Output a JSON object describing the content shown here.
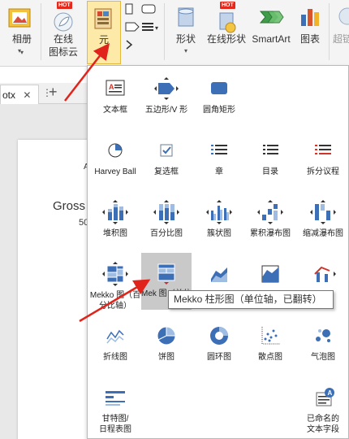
{
  "ribbon": {
    "buttons": [
      {
        "label1": "",
        "label2": ""
      },
      {
        "label1": "相册",
        "label2": ""
      },
      {
        "label1": "在线",
        "label2": "图标云"
      },
      {
        "label1": "元",
        "label2": ""
      },
      {
        "label1": "形状",
        "label2": ""
      },
      {
        "label1": "在线形状",
        "label2": ""
      },
      {
        "label1": "SmartArt",
        "label2": ""
      },
      {
        "label1": "图表",
        "label2": ""
      },
      {
        "label1": "超链",
        "label2": ""
      }
    ],
    "hot_badge": "HOT"
  },
  "document": {
    "tab_label": "otx",
    "add_tab": "+",
    "text_gross": "Gross",
    "text_value": "50",
    "text_marker": "A"
  },
  "gallery": {
    "items": [
      {
        "label": "文本框",
        "icon": "text-box-icon"
      },
      {
        "label": "五边形/V 形",
        "icon": "pentagon-chevron-icon"
      },
      {
        "label": "圆角矩形",
        "icon": "rounded-rectangle-icon"
      },
      {
        "label": "Harvey Ball",
        "icon": "harvey-ball-icon"
      },
      {
        "label": "复选框",
        "icon": "checkbox-icon"
      },
      {
        "label": "章",
        "icon": "chapter-list-icon"
      },
      {
        "label": "目录",
        "icon": "toc-icon"
      },
      {
        "label": "拆分议程",
        "icon": "split-agenda-icon"
      },
      {
        "label": "堆积图",
        "icon": "stacked-chart-icon"
      },
      {
        "label": "百分比图",
        "icon": "percent-chart-icon"
      },
      {
        "label": "簇状图",
        "icon": "clustered-chart-icon"
      },
      {
        "label": "累积瀑布图",
        "icon": "cumulative-waterfall-icon"
      },
      {
        "label": "缩减瀑布图",
        "icon": "reduced-waterfall-icon"
      },
      {
        "label": "Mekko 图（百分比轴）",
        "icon": "mekko-percent-icon"
      },
      {
        "label": "Mekko 柱形图（单位轴，已翻转）",
        "icon": "mekko-column-icon"
      },
      {
        "label": "",
        "icon": "area-chart-icon"
      },
      {
        "label": "",
        "icon": "area-chart-2-icon"
      },
      {
        "label": "",
        "icon": "line-chart-red-icon"
      },
      {
        "label": "折线图",
        "icon": "line-chart-icon"
      },
      {
        "label": "饼图",
        "icon": "pie-chart-icon"
      },
      {
        "label": "圆环图",
        "icon": "doughnut-chart-icon"
      },
      {
        "label": "散点图",
        "icon": "scatter-chart-icon"
      },
      {
        "label": "气泡图",
        "icon": "bubble-chart-icon"
      },
      {
        "label": "甘特图/日程表图",
        "icon": "gantt-chart-icon"
      },
      {
        "label": "已命名的文本字段",
        "icon": "named-text-field-icon"
      }
    ],
    "label_mekko_short": "Mekko 图（百分比轴）",
    "label_mekko2_short": "Mek 图（单位",
    "label_gantt": "甘特图/\n日程表图",
    "label_named": "已命名的\n文本字段"
  },
  "tooltip": {
    "text": "Mekko 柱形图（单位轴，已翻转）"
  },
  "colors": {
    "accent_blue": "#3d6fb6",
    "arrow_red": "#e0241b",
    "selected_bg": "#fde9a8"
  }
}
